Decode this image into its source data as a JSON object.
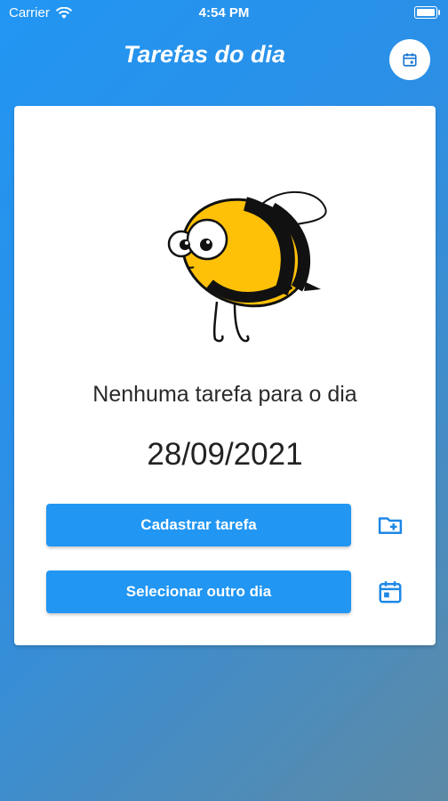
{
  "status_bar": {
    "carrier": "Carrier",
    "time": "4:54 PM"
  },
  "app_bar": {
    "title": "Tarefas do dia",
    "calendar_button_icon": "calendar-icon"
  },
  "main": {
    "empty_message": "Nenhuma tarefa para o dia",
    "date": "28/09/2021",
    "buttons": {
      "register_task": "Cadastrar tarefa",
      "register_icon": "folder-add-icon",
      "select_day": "Selecionar outro dia",
      "select_icon": "calendar-icon"
    }
  },
  "colors": {
    "accent": "#2196F3",
    "card": "#FFFFFF",
    "text": "#222222"
  }
}
